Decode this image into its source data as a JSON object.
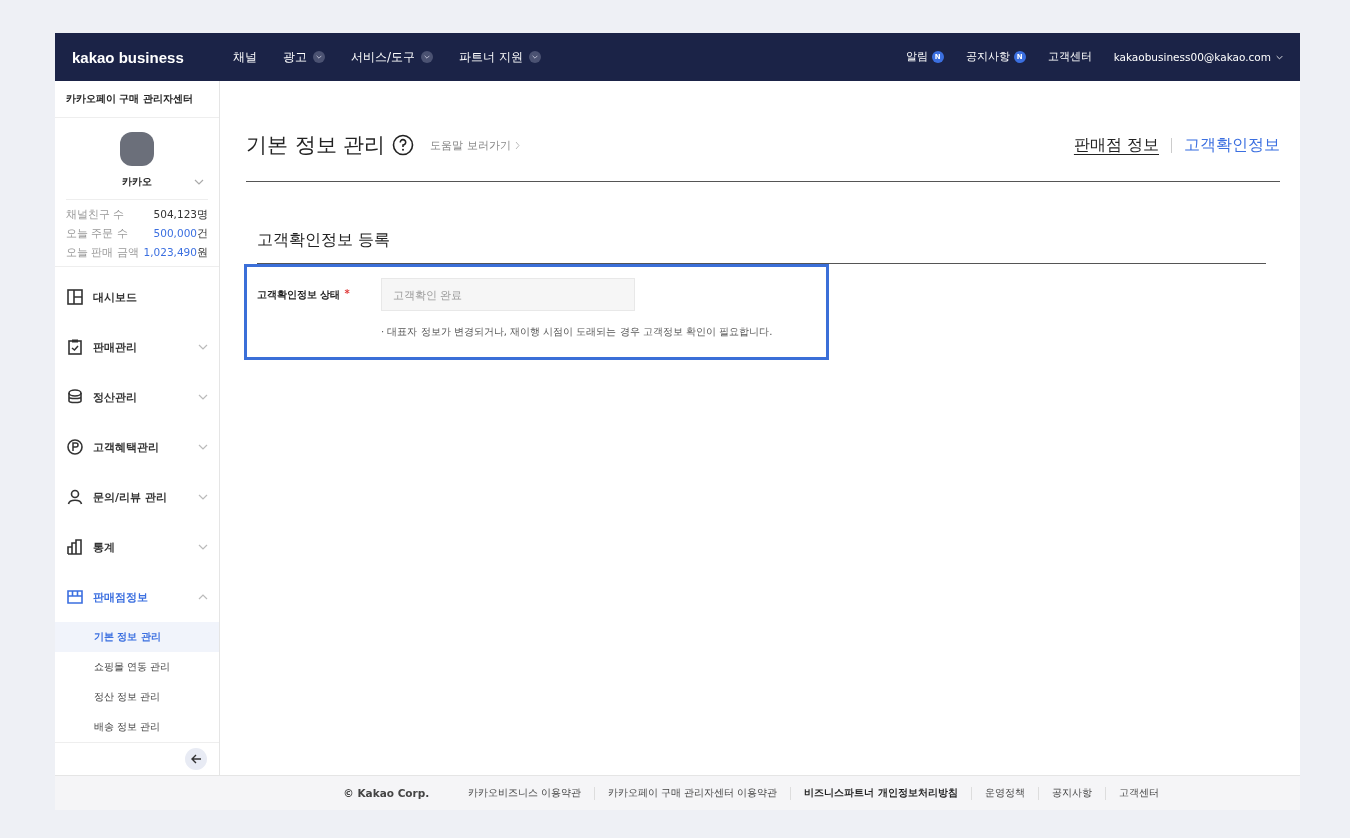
{
  "topbar": {
    "logo": "kakao business",
    "nav": [
      {
        "label": "채널",
        "dropdown": false
      },
      {
        "label": "광고",
        "dropdown": true
      },
      {
        "label": "서비스/도구",
        "dropdown": true
      },
      {
        "label": "파트너 지원",
        "dropdown": true
      }
    ],
    "links": [
      {
        "label": "알림",
        "badge": "N"
      },
      {
        "label": "공지사항",
        "badge": "N"
      },
      {
        "label": "고객센터"
      }
    ],
    "account": "kakaobusiness00@kakao.com"
  },
  "sidebar": {
    "title": "카카오페이 구매 관리자센터",
    "profile_name": "카카오",
    "stats": [
      {
        "label": "채널친구 수",
        "value": "504,123",
        "unit": "명",
        "highlight": false
      },
      {
        "label": "오늘 주문 수",
        "value": "500,000",
        "unit": "건",
        "highlight": true
      },
      {
        "label": "오늘 판매 금액",
        "value": "1,023,490",
        "unit": "원",
        "highlight": true
      }
    ],
    "items": [
      {
        "kind": "dashboard",
        "label": "대시보드",
        "selected": false
      },
      {
        "kind": "clipboard",
        "label": "판매관리",
        "selected": false,
        "expanded": false
      },
      {
        "kind": "coins",
        "label": "정산관리",
        "selected": false,
        "expanded": false
      },
      {
        "kind": "point",
        "label": "고객혜택관리",
        "selected": false,
        "expanded": false
      },
      {
        "kind": "person",
        "label": "문의/리뷰 관리",
        "selected": false,
        "expanded": false
      },
      {
        "kind": "chart",
        "label": "통계",
        "selected": false,
        "expanded": false
      },
      {
        "kind": "store",
        "label": "판매점정보",
        "selected": true,
        "expanded": true,
        "children": [
          {
            "label": "기본 정보 관리",
            "selected": true
          },
          {
            "label": "쇼핑몰 연동 관리",
            "selected": false
          },
          {
            "label": "정산 정보 관리",
            "selected": false
          },
          {
            "label": "배송 정보 관리",
            "selected": false
          }
        ]
      }
    ]
  },
  "page": {
    "title": "기본 정보 관리",
    "help_link": "도움말 보러가기",
    "tabs": [
      {
        "label": "판매점 정보",
        "selected": false
      },
      {
        "label": "고객확인정보",
        "selected": true
      }
    ],
    "section_title": "고객확인정보 등록",
    "field": {
      "label": "고객확인정보 상태",
      "required_mark": "*",
      "placeholder": "고객확인 완료",
      "note": "· 대표자 정보가 변경되거나, 재이행 시점이 도래되는 경우 고객정보 확인이 필요합니다."
    }
  },
  "footer": {
    "copyright": "© Kakao Corp.",
    "links": [
      {
        "label": "카카오비즈니스 이용약관",
        "bold": false
      },
      {
        "label": "카카오페이 구매 관리자센터 이용약관",
        "bold": false
      },
      {
        "label": "비즈니스파트너 개인정보처리방침",
        "bold": true
      },
      {
        "label": "운영정책",
        "bold": false
      },
      {
        "label": "공지사항",
        "bold": false
      },
      {
        "label": "고객센터",
        "bold": false
      }
    ]
  }
}
